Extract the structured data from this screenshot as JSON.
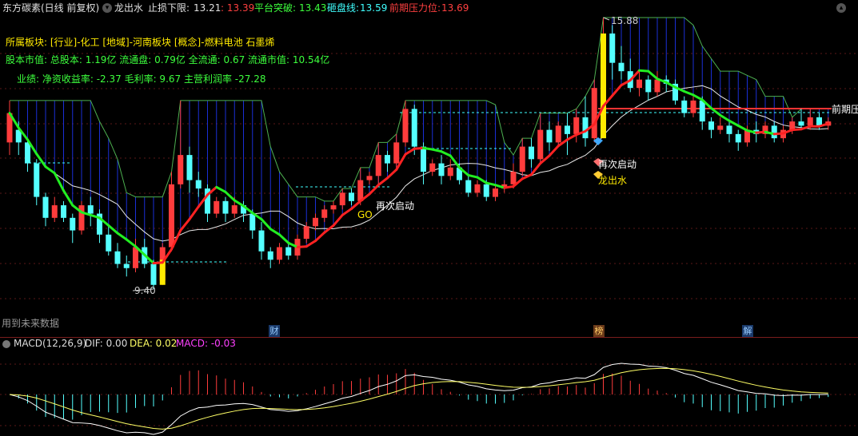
{
  "header": {
    "stock_name": "东方碳素(日线 前复权)",
    "indicator_name": "龙出水",
    "stop_loss_label": "止损下限:",
    "stop_loss_value": "13.21",
    "stop_loss_value2": ": 13.39",
    "breakout_label": "平台突破:",
    "breakout_value": "13.43",
    "crush_label": "砸盘线:",
    "crush_value": "13.59",
    "pressure_label": "前期压力位:",
    "pressure_value": "13.69"
  },
  "info": {
    "sector_line": "所属板块: [行业]-化工 [地域]-河南板块 [概念]-燃料电池 石墨烯",
    "capital_line": "股本市值: 总股本: 1.19亿 流通盘: 0.79亿 全流通: 0.67 流通市值: 10.54亿",
    "perf_line": "业绩: 净资收益率: -2.37 毛利率: 9.67 主营利润率 -27.28"
  },
  "annotations": {
    "high_price": "15.88",
    "low_price": "9.40",
    "restart1": "再次启动",
    "restart2": "再次启动",
    "go": "GO",
    "dragon": "龙出水",
    "prev_pressure": "前期压"
  },
  "future_data_note": "用到未来数据",
  "event_markers": {
    "cai": "财",
    "bang": "榜",
    "jie": "解"
  },
  "macd": {
    "label": "MACD(12,26,9)",
    "dif": "DIF: 0.00",
    "dea": "DEA: 0.02",
    "macd": "MACD: -0.03"
  },
  "colors": {
    "up": "#ff3c3c",
    "down": "#54ffff",
    "ma_green": "#22ee22",
    "ma_red": "#ff2222",
    "yellow": "#ffea00",
    "pressure_line": "#ff3333",
    "macd_dea": "#ffff66",
    "macd_label": "#ff40ff"
  },
  "chart_data": {
    "type": "candlestick",
    "price_range": [
      9.4,
      15.88
    ],
    "candles": [
      [
        12.9,
        13.6,
        12.6,
        13.9
      ],
      [
        13.2,
        12.9,
        12.6,
        13.4
      ],
      [
        12.9,
        12.4,
        12.2,
        13.0
      ],
      [
        12.4,
        11.6,
        11.4,
        12.5
      ],
      [
        11.6,
        11.1,
        10.9,
        11.7
      ],
      [
        11.1,
        11.4,
        11.0,
        11.6
      ],
      [
        11.4,
        11.1,
        11.0,
        11.5
      ],
      [
        11.1,
        10.8,
        10.5,
        11.2
      ],
      [
        10.8,
        11.4,
        10.7,
        11.5
      ],
      [
        11.4,
        11.2,
        10.9,
        11.6
      ],
      [
        11.2,
        10.7,
        10.5,
        11.3
      ],
      [
        10.7,
        10.3,
        10.2,
        10.9
      ],
      [
        10.3,
        10.0,
        9.9,
        10.5
      ],
      [
        10.0,
        9.9,
        9.7,
        10.2
      ],
      [
        9.9,
        10.4,
        9.8,
        10.6
      ],
      [
        10.4,
        10.0,
        9.9,
        10.6
      ],
      [
        10.0,
        9.5,
        9.4,
        10.1
      ],
      [
        9.6,
        10.4,
        9.5,
        10.5
      ],
      [
        10.4,
        11.9,
        10.3,
        12.2
      ],
      [
        11.9,
        12.6,
        11.8,
        13.9
      ],
      [
        12.6,
        12.0,
        11.7,
        12.8
      ],
      [
        12.0,
        11.8,
        11.6,
        12.2
      ],
      [
        11.8,
        11.2,
        11.0,
        11.9
      ],
      [
        11.2,
        11.5,
        11.1,
        11.6
      ],
      [
        11.5,
        11.2,
        11.0,
        11.6
      ],
      [
        11.2,
        11.4,
        11.1,
        11.6
      ],
      [
        11.4,
        11.2,
        11.0,
        11.5
      ],
      [
        11.2,
        10.8,
        10.6,
        11.3
      ],
      [
        10.8,
        10.3,
        10.1,
        11.0
      ],
      [
        10.3,
        10.1,
        9.9,
        10.4
      ],
      [
        10.1,
        10.4,
        10.0,
        10.5
      ],
      [
        10.4,
        10.2,
        10.1,
        10.5
      ],
      [
        10.2,
        10.6,
        10.1,
        10.7
      ],
      [
        10.6,
        10.9,
        10.5,
        11.0
      ],
      [
        10.9,
        11.1,
        10.8,
        11.2
      ],
      [
        11.1,
        11.3,
        11.0,
        11.4
      ],
      [
        11.3,
        11.4,
        11.2,
        11.5
      ],
      [
        11.4,
        11.7,
        11.3,
        11.8
      ],
      [
        11.7,
        11.5,
        11.4,
        11.8
      ],
      [
        11.5,
        12.0,
        11.4,
        12.3
      ],
      [
        12.0,
        12.1,
        11.9,
        12.2
      ],
      [
        12.1,
        12.6,
        11.9,
        12.9
      ],
      [
        12.6,
        12.4,
        12.2,
        12.7
      ],
      [
        12.4,
        12.9,
        12.3,
        13.1
      ],
      [
        12.9,
        13.7,
        12.8,
        13.9
      ],
      [
        13.7,
        12.8,
        12.6,
        13.8
      ],
      [
        12.8,
        12.2,
        11.9,
        12.9
      ],
      [
        12.2,
        12.4,
        12.1,
        12.5
      ],
      [
        12.4,
        12.1,
        11.9,
        12.6
      ],
      [
        12.1,
        12.3,
        12.0,
        12.5
      ],
      [
        12.3,
        12.0,
        11.9,
        12.4
      ],
      [
        12.0,
        11.7,
        11.6,
        12.1
      ],
      [
        11.7,
        11.9,
        11.6,
        12.0
      ],
      [
        11.9,
        11.6,
        11.5,
        12.0
      ],
      [
        11.6,
        11.8,
        11.5,
        11.9
      ],
      [
        11.8,
        11.9,
        11.7,
        12.0
      ],
      [
        11.9,
        12.2,
        11.8,
        12.4
      ],
      [
        12.2,
        12.8,
        12.1,
        13.0
      ],
      [
        12.8,
        12.5,
        12.3,
        13.0
      ],
      [
        12.5,
        13.2,
        12.4,
        13.6
      ],
      [
        13.2,
        12.9,
        12.7,
        13.4
      ],
      [
        12.9,
        13.3,
        12.8,
        13.4
      ],
      [
        13.3,
        13.1,
        12.6,
        13.6
      ],
      [
        13.1,
        13.5,
        12.9,
        13.7
      ],
      [
        13.5,
        13.0,
        12.8,
        14.0
      ],
      [
        13.0,
        14.2,
        12.9,
        14.4
      ],
      [
        14.2,
        15.5,
        13.2,
        15.88
      ],
      [
        15.5,
        14.8,
        14.4,
        15.7
      ],
      [
        14.8,
        14.6,
        14.4,
        15.2
      ],
      [
        14.6,
        14.2,
        14.1,
        14.9
      ],
      [
        14.2,
        14.4,
        14.0,
        14.6
      ],
      [
        14.4,
        14.1,
        13.9,
        14.5
      ],
      [
        14.1,
        14.4,
        14.0,
        14.6
      ],
      [
        14.4,
        14.3,
        14.1,
        14.5
      ],
      [
        14.3,
        13.9,
        13.8,
        14.4
      ],
      [
        13.9,
        13.6,
        13.5,
        14.0
      ],
      [
        13.6,
        13.9,
        13.5,
        14.0
      ],
      [
        13.9,
        13.4,
        13.2,
        14.0
      ],
      [
        13.4,
        13.2,
        13.0,
        13.5
      ],
      [
        13.2,
        13.3,
        13.1,
        13.5
      ],
      [
        13.3,
        13.1,
        12.9,
        13.4
      ],
      [
        13.1,
        12.9,
        12.7,
        13.2
      ],
      [
        12.9,
        13.2,
        12.8,
        13.3
      ],
      [
        13.2,
        13.1,
        12.9,
        13.4
      ],
      [
        13.1,
        13.3,
        13.0,
        13.4
      ],
      [
        13.3,
        13.0,
        12.9,
        13.4
      ],
      [
        13.0,
        13.2,
        12.9,
        13.3
      ],
      [
        13.2,
        13.4,
        13.1,
        13.5
      ],
      [
        13.4,
        13.3,
        13.2,
        13.7
      ],
      [
        13.3,
        13.5,
        13.2,
        13.7
      ],
      [
        13.5,
        13.3,
        13.2,
        13.6
      ],
      [
        13.3,
        13.4,
        13.2,
        13.5
      ]
    ],
    "series": [
      {
        "name": "DIF",
        "values": []
      },
      {
        "name": "DEA",
        "values": []
      }
    ]
  }
}
